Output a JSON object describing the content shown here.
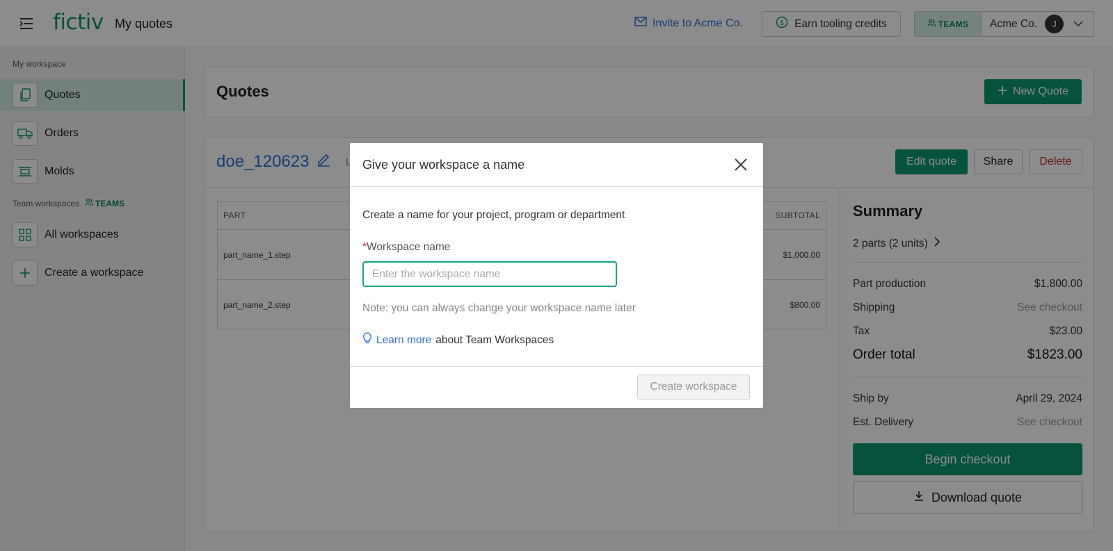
{
  "header": {
    "logo": "fictiv",
    "page_title": "My quotes",
    "invite_label": "Invite to Acme Co.",
    "earn_label": "Earn tooling credits",
    "teams_label": "TEAMS",
    "account_name": "Acme Co.",
    "avatar_initial": "J"
  },
  "sidebar": {
    "my_workspace_label": "My workspace",
    "items": [
      {
        "label": "Quotes",
        "icon": "document-copy-icon",
        "active": true
      },
      {
        "label": "Orders",
        "icon": "truck-icon",
        "active": false
      },
      {
        "label": "Molds",
        "icon": "mold-icon",
        "active": false
      }
    ],
    "team_workspaces_label": "Team workspaces",
    "teams_badge": "TEAMS",
    "team_items": [
      {
        "label": "All workspaces",
        "icon": "grid-icon"
      },
      {
        "label": "Create a workspace",
        "icon": "plus-icon"
      }
    ]
  },
  "quotes_card": {
    "title": "Quotes",
    "new_quote_label": "New Quote"
  },
  "quote_detail": {
    "name": "doe_120623",
    "sub_fragment": "L",
    "edit_label": "Edit quote",
    "share_label": "Share",
    "delete_label": "Delete",
    "table": {
      "col_part": "PART",
      "col_subtotal": "SUBTOTAL",
      "rows": [
        {
          "part": "part_name_1.step",
          "subtotal": "$1,000.00"
        },
        {
          "part": "part_name_2.step",
          "subtotal": "$800.00"
        }
      ]
    }
  },
  "summary": {
    "title": "Summary",
    "parts_count": "2 parts (2 units)",
    "part_production_label": "Part production",
    "part_production_value": "$1,800.00",
    "shipping_label": "Shipping",
    "shipping_value": "See checkout",
    "tax_label": "Tax",
    "tax_value": "$23.00",
    "order_total_label": "Order total",
    "order_total_value": "$1823.00",
    "ship_by_label": "Ship by",
    "ship_by_value": "April 29, 2024",
    "delivery_label": "Est. Delivery",
    "delivery_value": "See checkout",
    "checkout_label": "Begin checkout",
    "download_label": "Download quote"
  },
  "modal": {
    "title": "Give your workspace a name",
    "description": "Create a name for your project, program or department",
    "required_mark": "*",
    "field_label": "Workspace name",
    "input_value": "",
    "input_placeholder": "Enter the workspace name",
    "note": "Note: you can always change your workspace name later",
    "learn_link": "Learn more",
    "learn_rest": "about Team Workspaces",
    "create_label": "Create workspace"
  },
  "colors": {
    "brand_green": "#0e9672",
    "link_blue": "#2f6fd8",
    "danger_red": "#c62828"
  }
}
